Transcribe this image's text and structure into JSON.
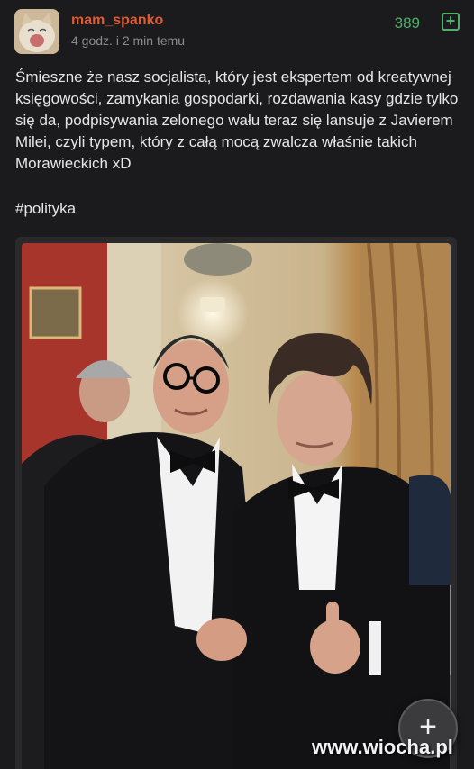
{
  "post": {
    "username": "mam_spanko",
    "timestamp": "4 godz. i 2 min temu",
    "votes": "389",
    "plus_icon": "plus-square-icon",
    "body": "Śmieszne że nasz socjalista, który jest ekspertem od kreatywnej księgowości, zamykania gospodarki, rozdawania kasy gdzie tylko się da, podpisywania zelonego wału teraz się lansuje z Javierem Milei, czyli typem, który z całą mocą zwalcza właśnie takich Morawieckich xD",
    "tag": "#polityka"
  },
  "fab": {
    "label": "+",
    "icon": "plus-icon"
  },
  "watermark": "www.wiocha.pl",
  "colors": {
    "username": "#e05b34",
    "votes": "#4fb06b",
    "background": "#1b1b1d"
  }
}
